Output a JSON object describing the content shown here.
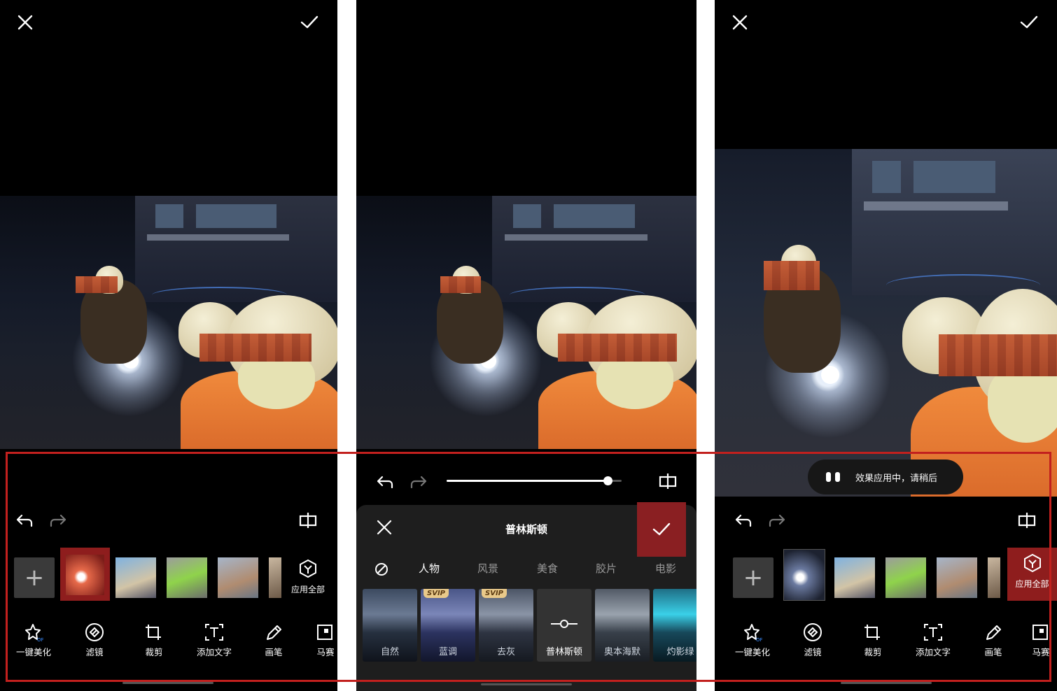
{
  "screens": [
    {
      "toolbar": {
        "undo": "undo-icon",
        "redo": "redo-icon",
        "compare": "compare-icon"
      },
      "apply_all_label": "应用全部",
      "tools": [
        "一键美化",
        "滤镜",
        "裁剪",
        "添加文字",
        "画笔",
        "马赛"
      ]
    },
    {
      "sheet_title": "普林斯顿",
      "categories": [
        "人物",
        "风景",
        "美食",
        "胶片",
        "电影"
      ],
      "active_category": "人物",
      "intensity": 0.92,
      "filters": [
        {
          "label": "自然",
          "badge": ""
        },
        {
          "label": "蓝调",
          "badge": "SVIP"
        },
        {
          "label": "去灰",
          "badge": "SVIP"
        },
        {
          "label": "普林斯顿",
          "badge": ""
        },
        {
          "label": "奥本海默",
          "badge": ""
        },
        {
          "label": "灼影绿",
          "badge": ""
        }
      ]
    },
    {
      "toast": "效果应用中，请稍后",
      "apply_all_label": "应用全部",
      "tools": [
        "一键美化",
        "滤镜",
        "裁剪",
        "添加文字",
        "画笔",
        "马赛"
      ]
    }
  ],
  "colors": {
    "accent_red": "#c2201e",
    "confirm_bg": "#8a1f22",
    "svip_gold": "#e9c98a"
  }
}
